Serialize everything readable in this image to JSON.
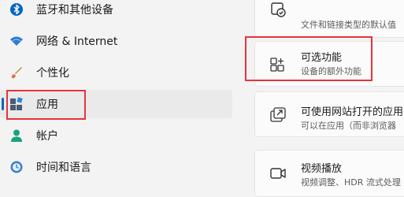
{
  "nav": {
    "items": [
      {
        "label": "蓝牙和其他设备",
        "icon": "bluetooth-icon"
      },
      {
        "label": "网络 & Internet",
        "icon": "wifi-icon"
      },
      {
        "label": "个性化",
        "icon": "brush-icon"
      },
      {
        "label": "应用",
        "icon": "apps-icon",
        "selected": true
      },
      {
        "label": "帐户",
        "icon": "account-icon"
      },
      {
        "label": "时间和语言",
        "icon": "time-language-icon"
      }
    ]
  },
  "cards": {
    "default_apps": {
      "subtitle": "文件和链接类型的默认值",
      "icon": "default-apps-icon"
    },
    "optional_features": {
      "title": "可选功能",
      "subtitle": "设备的额外功能",
      "icon": "optional-features-icon"
    },
    "apps_for_websites": {
      "title": "可使用网站打开的应用",
      "subtitle": "可以在应用（而非浏览器",
      "icon": "open-link-icon"
    },
    "video_playback": {
      "title": "视频播放",
      "subtitle": "视频调整、HDR 流式处理",
      "icon": "video-icon"
    }
  },
  "colors": {
    "accent": "#0067c0",
    "highlight_box": "#e8333b",
    "background": "#f3f3f3"
  }
}
